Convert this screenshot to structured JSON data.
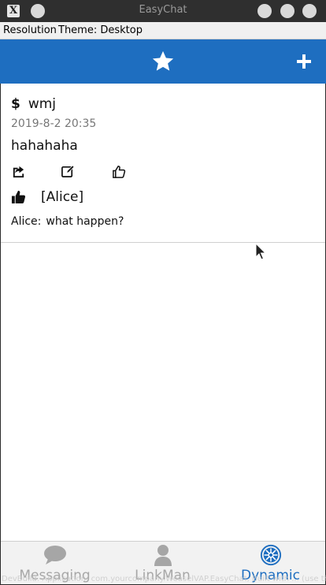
{
  "window": {
    "title": "EasyChat",
    "logo": "X"
  },
  "menu": {
    "items": [
      "Resolution",
      "Theme: Desktop"
    ]
  },
  "header": {
    "center_icon": "star-icon",
    "right_icon": "plus-icon",
    "accent_color": "#1e6ec0"
  },
  "post": {
    "author_symbol": "$",
    "author": "wmj",
    "time": "2019-8-2 20:35",
    "body": "hahahaha",
    "actions": [
      "share-icon",
      "edit-icon",
      "thumbs-up-icon"
    ],
    "likes": "[Alice]",
    "comment_author": "Alice:",
    "comment_text": "what happen?"
  },
  "tabs": [
    {
      "label": "Messaging",
      "icon": "chat-bubble-icon",
      "active": false
    },
    {
      "label": "LinkMan",
      "icon": "person-icon",
      "active": false
    },
    {
      "label": "Dynamic",
      "icon": "dynamic-icon",
      "active": true
    }
  ],
  "dev_banner": "DevBuild. Application: com.yourcompany.WeaselVAP.EasyChat, Built with ... (use th"
}
